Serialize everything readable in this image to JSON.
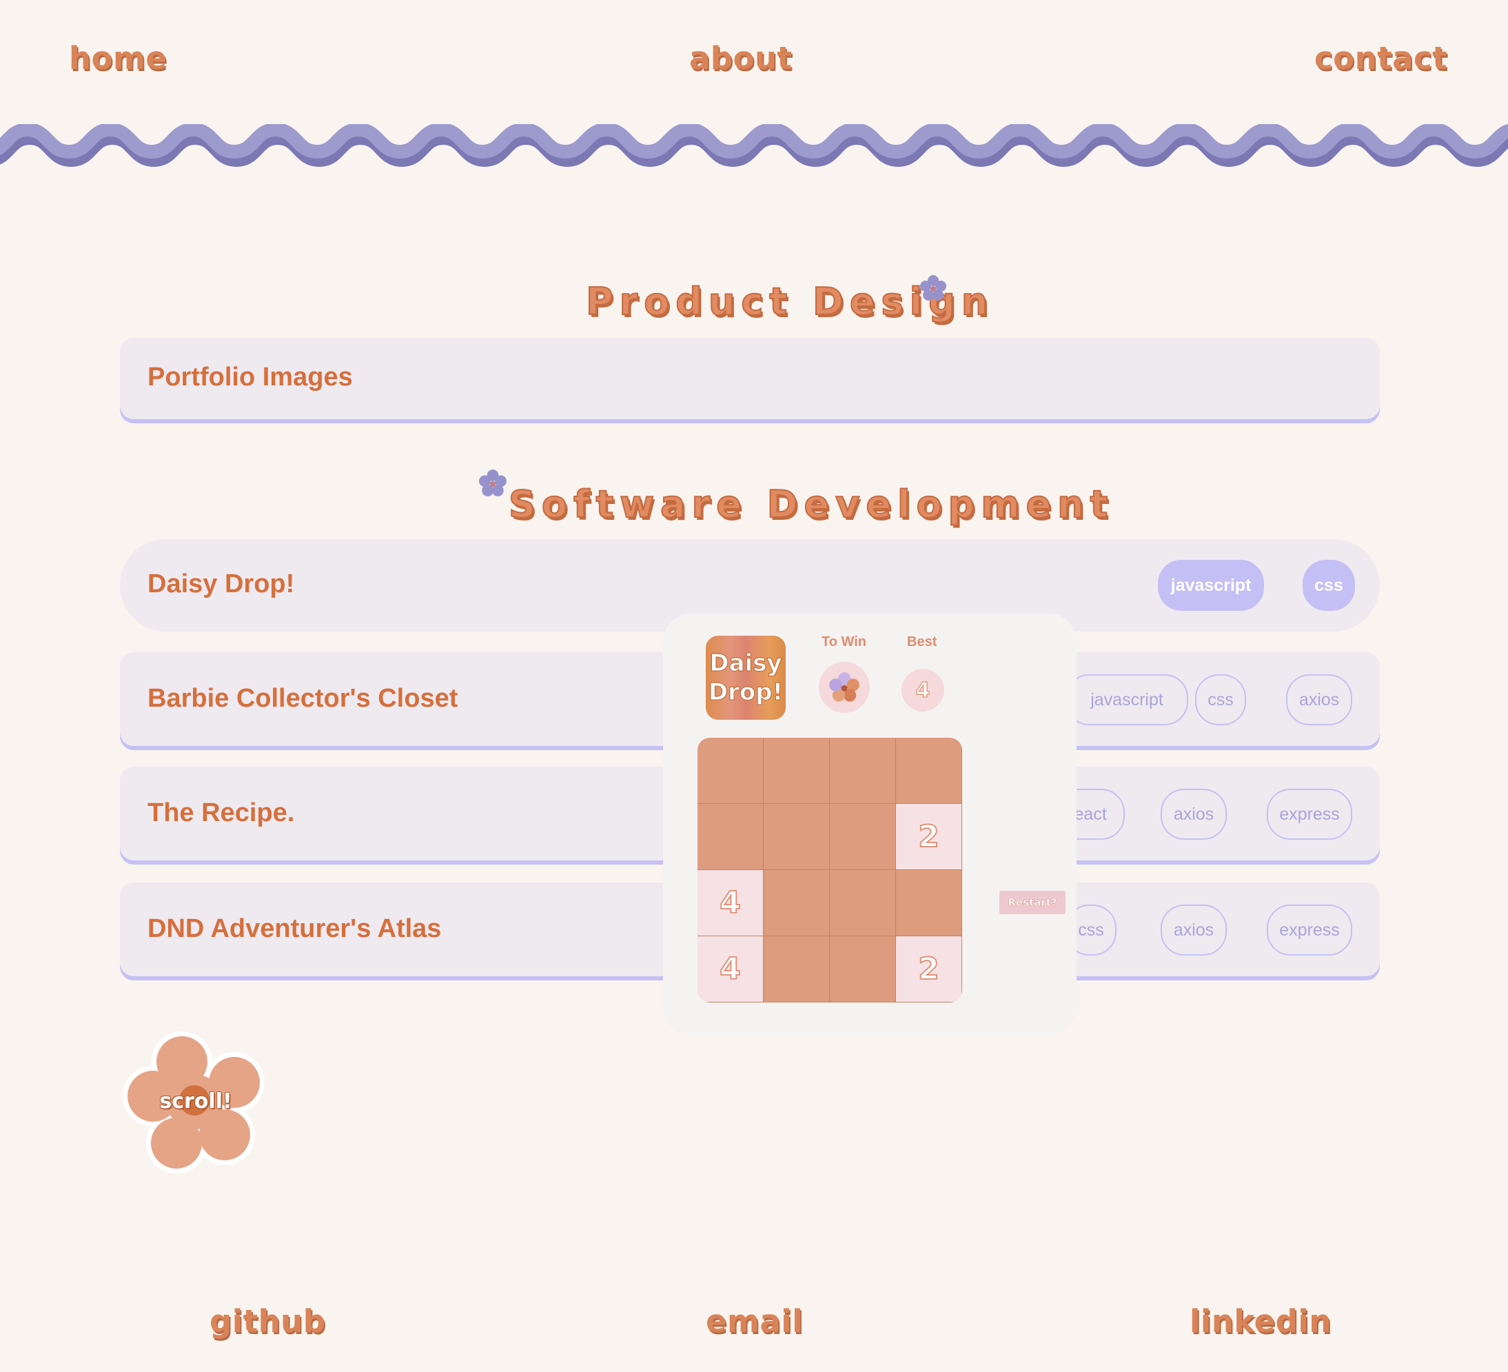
{
  "nav": {
    "home": "home",
    "about": "about",
    "contact": "contact"
  },
  "sections": {
    "product_design": {
      "title": "Product Design"
    },
    "software_development": {
      "title": "Software Development"
    }
  },
  "cards": {
    "portfolio": {
      "title": "Portfolio Images"
    },
    "daisy": {
      "title": "Daisy Drop!",
      "tags": [
        "javascript",
        "css"
      ]
    },
    "barbie": {
      "title": "Barbie Collector's Closet",
      "tags": [
        "javascript",
        "css",
        "axios"
      ]
    },
    "recipe": {
      "title": "The Recipe.",
      "tags": [
        "react",
        "axios",
        "express"
      ]
    },
    "dnd": {
      "title": "DND Adventurer's Atlas",
      "tags": [
        "css",
        "axios",
        "express"
      ]
    }
  },
  "game": {
    "logo_line1": "Daisy",
    "logo_line2": "Drop!",
    "to_win_label": "To Win",
    "best_label": "Best",
    "best_value": "4",
    "restart_label": "Restart?",
    "board": [
      [
        "",
        "",
        "",
        ""
      ],
      [
        "",
        "",
        "",
        "2"
      ],
      [
        "4",
        "",
        "",
        ""
      ],
      [
        "4",
        "",
        "",
        "2"
      ]
    ]
  },
  "scroll": {
    "label": "scroll!"
  },
  "footer": {
    "github": "github",
    "email": "email",
    "linkedin": "linkedin"
  },
  "colors": {
    "background": "#f9f4f0",
    "accent_orange": "#d66f3c",
    "wave_purple": "#9a98cc",
    "tag_purple": "#c4bff4",
    "card_bg": "#efeaf0"
  }
}
